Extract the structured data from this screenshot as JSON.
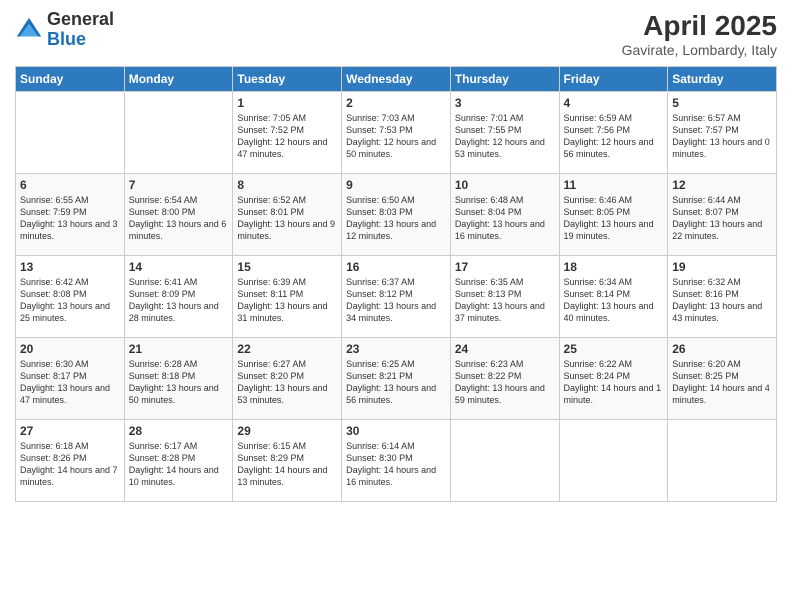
{
  "header": {
    "logo_general": "General",
    "logo_blue": "Blue",
    "month_title": "April 2025",
    "location": "Gavirate, Lombardy, Italy"
  },
  "days_of_week": [
    "Sunday",
    "Monday",
    "Tuesday",
    "Wednesday",
    "Thursday",
    "Friday",
    "Saturday"
  ],
  "weeks": [
    [
      {
        "day": "",
        "content": ""
      },
      {
        "day": "",
        "content": ""
      },
      {
        "day": "1",
        "content": "Sunrise: 7:05 AM\nSunset: 7:52 PM\nDaylight: 12 hours and 47 minutes."
      },
      {
        "day": "2",
        "content": "Sunrise: 7:03 AM\nSunset: 7:53 PM\nDaylight: 12 hours and 50 minutes."
      },
      {
        "day": "3",
        "content": "Sunrise: 7:01 AM\nSunset: 7:55 PM\nDaylight: 12 hours and 53 minutes."
      },
      {
        "day": "4",
        "content": "Sunrise: 6:59 AM\nSunset: 7:56 PM\nDaylight: 12 hours and 56 minutes."
      },
      {
        "day": "5",
        "content": "Sunrise: 6:57 AM\nSunset: 7:57 PM\nDaylight: 13 hours and 0 minutes."
      }
    ],
    [
      {
        "day": "6",
        "content": "Sunrise: 6:55 AM\nSunset: 7:59 PM\nDaylight: 13 hours and 3 minutes."
      },
      {
        "day": "7",
        "content": "Sunrise: 6:54 AM\nSunset: 8:00 PM\nDaylight: 13 hours and 6 minutes."
      },
      {
        "day": "8",
        "content": "Sunrise: 6:52 AM\nSunset: 8:01 PM\nDaylight: 13 hours and 9 minutes."
      },
      {
        "day": "9",
        "content": "Sunrise: 6:50 AM\nSunset: 8:03 PM\nDaylight: 13 hours and 12 minutes."
      },
      {
        "day": "10",
        "content": "Sunrise: 6:48 AM\nSunset: 8:04 PM\nDaylight: 13 hours and 16 minutes."
      },
      {
        "day": "11",
        "content": "Sunrise: 6:46 AM\nSunset: 8:05 PM\nDaylight: 13 hours and 19 minutes."
      },
      {
        "day": "12",
        "content": "Sunrise: 6:44 AM\nSunset: 8:07 PM\nDaylight: 13 hours and 22 minutes."
      }
    ],
    [
      {
        "day": "13",
        "content": "Sunrise: 6:42 AM\nSunset: 8:08 PM\nDaylight: 13 hours and 25 minutes."
      },
      {
        "day": "14",
        "content": "Sunrise: 6:41 AM\nSunset: 8:09 PM\nDaylight: 13 hours and 28 minutes."
      },
      {
        "day": "15",
        "content": "Sunrise: 6:39 AM\nSunset: 8:11 PM\nDaylight: 13 hours and 31 minutes."
      },
      {
        "day": "16",
        "content": "Sunrise: 6:37 AM\nSunset: 8:12 PM\nDaylight: 13 hours and 34 minutes."
      },
      {
        "day": "17",
        "content": "Sunrise: 6:35 AM\nSunset: 8:13 PM\nDaylight: 13 hours and 37 minutes."
      },
      {
        "day": "18",
        "content": "Sunrise: 6:34 AM\nSunset: 8:14 PM\nDaylight: 13 hours and 40 minutes."
      },
      {
        "day": "19",
        "content": "Sunrise: 6:32 AM\nSunset: 8:16 PM\nDaylight: 13 hours and 43 minutes."
      }
    ],
    [
      {
        "day": "20",
        "content": "Sunrise: 6:30 AM\nSunset: 8:17 PM\nDaylight: 13 hours and 47 minutes."
      },
      {
        "day": "21",
        "content": "Sunrise: 6:28 AM\nSunset: 8:18 PM\nDaylight: 13 hours and 50 minutes."
      },
      {
        "day": "22",
        "content": "Sunrise: 6:27 AM\nSunset: 8:20 PM\nDaylight: 13 hours and 53 minutes."
      },
      {
        "day": "23",
        "content": "Sunrise: 6:25 AM\nSunset: 8:21 PM\nDaylight: 13 hours and 56 minutes."
      },
      {
        "day": "24",
        "content": "Sunrise: 6:23 AM\nSunset: 8:22 PM\nDaylight: 13 hours and 59 minutes."
      },
      {
        "day": "25",
        "content": "Sunrise: 6:22 AM\nSunset: 8:24 PM\nDaylight: 14 hours and 1 minute."
      },
      {
        "day": "26",
        "content": "Sunrise: 6:20 AM\nSunset: 8:25 PM\nDaylight: 14 hours and 4 minutes."
      }
    ],
    [
      {
        "day": "27",
        "content": "Sunrise: 6:18 AM\nSunset: 8:26 PM\nDaylight: 14 hours and 7 minutes."
      },
      {
        "day": "28",
        "content": "Sunrise: 6:17 AM\nSunset: 8:28 PM\nDaylight: 14 hours and 10 minutes."
      },
      {
        "day": "29",
        "content": "Sunrise: 6:15 AM\nSunset: 8:29 PM\nDaylight: 14 hours and 13 minutes."
      },
      {
        "day": "30",
        "content": "Sunrise: 6:14 AM\nSunset: 8:30 PM\nDaylight: 14 hours and 16 minutes."
      },
      {
        "day": "",
        "content": ""
      },
      {
        "day": "",
        "content": ""
      },
      {
        "day": "",
        "content": ""
      }
    ]
  ]
}
